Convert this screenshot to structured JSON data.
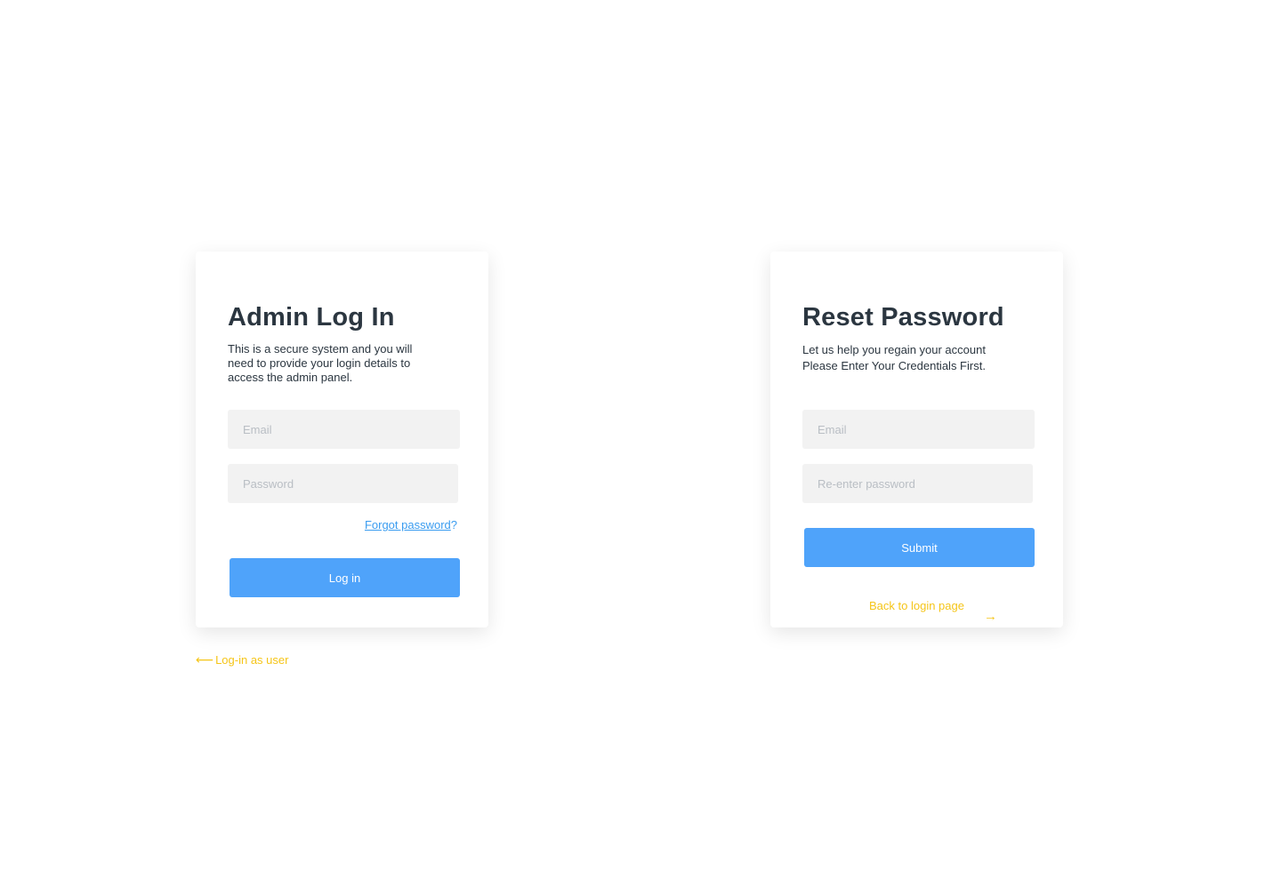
{
  "login_card": {
    "title": "Admin Log In",
    "description_lines": [
      "This is a secure system and you will",
      "need to provide your login details to",
      "access the admin panel."
    ],
    "email_placeholder": "Email",
    "password_placeholder": "Password",
    "forgot_link_text": "Forgot password",
    "forgot_suffix": "?",
    "login_button": "Log in"
  },
  "user_login_link": {
    "arrow": "⟵",
    "label": "Log-in as user"
  },
  "reset_card": {
    "title": "Reset Password",
    "description_lines": [
      "Let us help you regain your account",
      "Please Enter Your Credentials First."
    ],
    "email_placeholder": "Email",
    "reenter_placeholder": "Re-enter password",
    "submit_button": "Submit",
    "back_link": "Back to login page",
    "back_arrow": "→"
  },
  "colors": {
    "primary_blue": "#4fa3fa",
    "link_blue": "#3a9cf0",
    "accent_yellow": "#f5c518",
    "heading_dark": "#2b3640",
    "field_bg": "#f2f2f2"
  }
}
